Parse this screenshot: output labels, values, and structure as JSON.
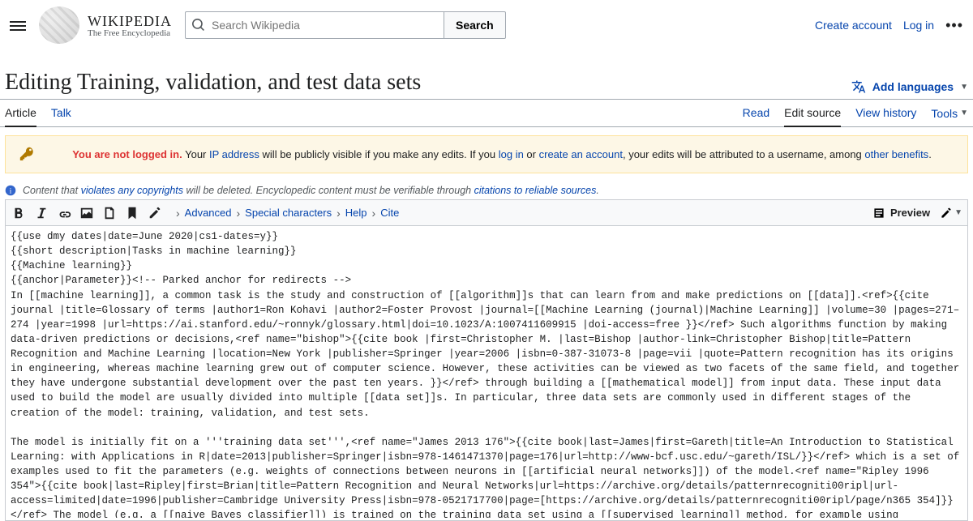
{
  "header": {
    "brand_main": "WIKIPEDIA",
    "brand_sub": "The Free Encyclopedia",
    "search_placeholder": "Search Wikipedia",
    "search_button": "Search",
    "create_account": "Create account",
    "log_in": "Log in"
  },
  "title": {
    "text": "Editing Training, validation, and test data sets",
    "add_languages": "Add languages"
  },
  "tabs": {
    "article": "Article",
    "talk": "Talk",
    "read": "Read",
    "edit_source": "Edit source",
    "view_history": "View history",
    "tools": "Tools"
  },
  "warning": {
    "not_logged_bold": "You are not logged in.",
    "seg1": " Your ",
    "ip_link": "IP address",
    "seg2": " will be publicly visible if you make any edits. If you ",
    "login_link": "log in",
    "seg3": " or ",
    "create_link": "create an account",
    "seg4": ", your edits will be attributed to a username, among ",
    "benefits_link": "other benefits",
    "seg5": "."
  },
  "copyright": {
    "pre": "Content that ",
    "violates_link": "violates any copyrights",
    "mid": " will be deleted. Encyclopedic content must be verifiable through ",
    "citations_link": "citations to reliable sources",
    "end": "."
  },
  "toolbar": {
    "advanced": "Advanced",
    "special": "Special characters",
    "help": "Help",
    "cite": "Cite",
    "preview": "Preview"
  },
  "editor_value": "{{use dmy dates|date=June 2020|cs1-dates=y}}\n{{short description|Tasks in machine learning}}\n{{Machine learning}}\n{{anchor|Parameter}}<!-- Parked anchor for redirects -->\nIn [[machine learning]], a common task is the study and construction of [[algorithm]]s that can learn from and make predictions on [[data]].<ref>{{cite journal |title=Glossary of terms |author1=Ron Kohavi |author2=Foster Provost |journal=[[Machine Learning (journal)|Machine Learning]] |volume=30 |pages=271–274 |year=1998 |url=https://ai.stanford.edu/~ronnyk/glossary.html|doi=10.1023/A:1007411609915 |doi-access=free }}</ref> Such algorithms function by making data-driven predictions or decisions,<ref name=\"bishop\">{{cite book |first=Christopher M. |last=Bishop |author-link=Christopher Bishop|title=Pattern Recognition and Machine Learning |location=New York |publisher=Springer |year=2006 |isbn=0-387-31073-8 |page=vii |quote=Pattern recognition has its origins in engineering, whereas machine learning grew out of computer science. However, these activities can be viewed as two facets of the same field, and together they have undergone substantial development over the past ten years. }}</ref> through building a [[mathematical model]] from input data. These input data used to build the model are usually divided into multiple [[data set]]s. In particular, three data sets are commonly used in different stages of the creation of the model: training, validation, and test sets.\n\nThe model is initially fit on a '''training data set''',<ref name=\"James 2013 176\">{{cite book|last=James|first=Gareth|title=An Introduction to Statistical Learning: with Applications in R|date=2013|publisher=Springer|isbn=978-1461471370|page=176|url=http://www-bcf.usc.edu/~gareth/ISL/}}</ref> which is a set of examples used to fit the parameters (e.g. weights of connections between neurons in [[artificial neural networks]]) of the model.<ref name=\"Ripley 1996 354\">{{cite book|last=Ripley|first=Brian|title=Pattern Recognition and Neural Networks|url=https://archive.org/details/patternrecogniti00ripl|url-access=limited|date=1996|publisher=Cambridge University Press|isbn=978-0521717700|page=[https://archive.org/details/patternrecogniti00ripl/page/n365 354]}}</ref> The model (e.g. a [[naive Bayes classifier]]) is trained on the training data set using a [[supervised learning]] method, for example using optimization methods such as [[gradient descent]] or [[stochastic gradient descent]]. In practice, the training data set often consists of pairs of an input [[Array data structure|vector]] (or scalar) and the corresponding output vector (or scalar), where the answer key is commonly denoted as the ''target'' (or ''label''). The current model is run with the training data set and produces a result, which is then compared with the ''target'', for each input vector in the training data set. Based on the result of the comparison and the specific learning algorithm being used, the parameters of the model are adjusted. The model fitting can include both [[feature selection|variable selection]] and parameter [[estimation theory|estimation]]."
}
